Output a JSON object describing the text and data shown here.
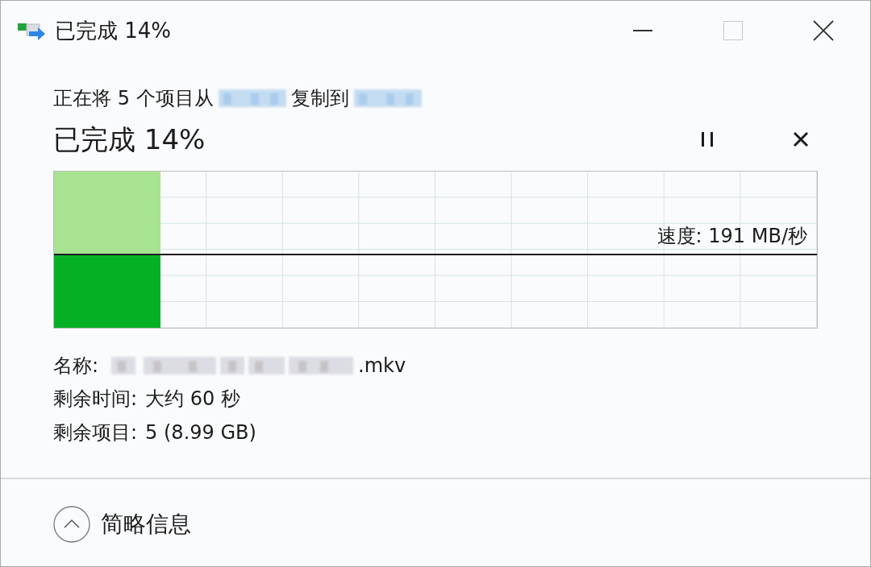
{
  "window": {
    "title": "已完成 14%"
  },
  "operation": {
    "parts": [
      {
        "kind": "text",
        "text": "正在将 5 个项目从"
      },
      {
        "kind": "redacted"
      },
      {
        "kind": "text",
        "text": "复制到"
      },
      {
        "kind": "redacted"
      }
    ]
  },
  "progress": {
    "heading": "已完成 14%",
    "level": 0.14,
    "speed_label": "速度: 191 MB/秒"
  },
  "details": [
    {
      "label": "名称:",
      "parts": [
        {
          "kind": "redacted"
        },
        {
          "kind": "text",
          "text": ".mkv"
        }
      ]
    },
    {
      "label": "剩余时间:",
      "parts": [
        {
          "kind": "text",
          "text": "大约 60 秒"
        }
      ]
    },
    {
      "label": "剩余项目:",
      "parts": [
        {
          "kind": "text",
          "text": "5 (8.99 GB)"
        }
      ]
    }
  ],
  "footer": {
    "toggle_label": "简略信息",
    "expanded": true
  }
}
